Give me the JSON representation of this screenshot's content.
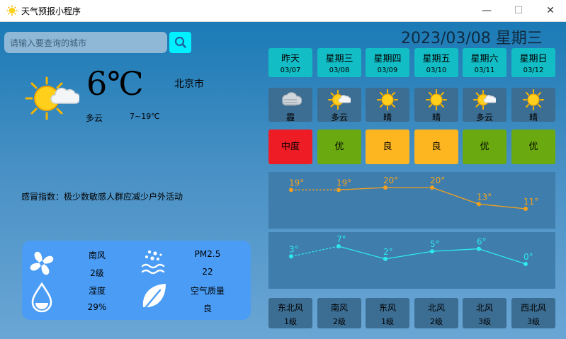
{
  "window": {
    "title": "天气预报小程序",
    "minimize": "—",
    "maximize": "☐",
    "close": "✕"
  },
  "search": {
    "placeholder": "请输入要查询的城市",
    "value": ""
  },
  "date_text": "2023/03/08 星期三",
  "current": {
    "temp": "6℃",
    "city": "北京市",
    "condition": "多云",
    "range": "7~19℃",
    "icon": "partly-cloudy-sun-icon"
  },
  "cold_index": "感冒指数：极少数敏感人群应减少户外活动",
  "details": {
    "wind_dir": "南风",
    "wind_level": "2级",
    "pm_label": "PM2.5",
    "pm_value": "22",
    "humidity_label": "湿度",
    "humidity_value": "29%",
    "air_label": "空气质量",
    "air_value": "良"
  },
  "days": [
    {
      "name": "昨天",
      "date": "03/07",
      "weather": "霾",
      "icon": "haze-icon",
      "aqi": "中度",
      "aqi_color": "#ee1c25",
      "high": 19,
      "low": 3,
      "wind": "东北风",
      "wind_level": "1级"
    },
    {
      "name": "星期三",
      "date": "03/08",
      "weather": "多云",
      "icon": "partly-cloudy-sun-icon",
      "aqi": "优",
      "aqi_color": "#6aa90f",
      "high": 19,
      "low": 7,
      "wind": "南风",
      "wind_level": "2级"
    },
    {
      "name": "星期四",
      "date": "03/09",
      "weather": "晴",
      "icon": "sun-icon",
      "aqi": "良",
      "aqi_color": "#fdb61f",
      "high": 20,
      "low": 2,
      "wind": "东风",
      "wind_level": "1级"
    },
    {
      "name": "星期五",
      "date": "03/10",
      "weather": "晴",
      "icon": "sun-icon",
      "aqi": "良",
      "aqi_color": "#fdb61f",
      "high": 20,
      "low": 5,
      "wind": "北风",
      "wind_level": "2级"
    },
    {
      "name": "星期六",
      "date": "03/11",
      "weather": "多云",
      "icon": "partly-cloudy-sun-icon",
      "aqi": "优",
      "aqi_color": "#6aa90f",
      "high": 13,
      "low": 6,
      "wind": "北风",
      "wind_level": "3级"
    },
    {
      "name": "星期日",
      "date": "03/12",
      "weather": "晴",
      "icon": "sun-icon",
      "aqi": "优",
      "aqi_color": "#6aa90f",
      "high": 11,
      "low": 0,
      "wind": "西北风",
      "wind_level": "3级"
    }
  ],
  "chart_data": [
    {
      "type": "line",
      "categories": [
        "03/07",
        "03/08",
        "03/09",
        "03/10",
        "03/11",
        "03/12"
      ],
      "series": [
        {
          "values": [
            19,
            19,
            20,
            20,
            13,
            11
          ],
          "color": "#f2a01e"
        }
      ],
      "point_labels": [
        "19°",
        "19°",
        "20°",
        "20°",
        "13°",
        "11°"
      ],
      "first_segment": "dashed"
    },
    {
      "type": "line",
      "categories": [
        "03/07",
        "03/08",
        "03/09",
        "03/10",
        "03/11",
        "03/12"
      ],
      "series": [
        {
          "values": [
            3,
            7,
            2,
            5,
            6,
            0
          ],
          "color": "#2ee8f0"
        }
      ],
      "point_labels": [
        "3°",
        "7°",
        "2°",
        "5°",
        "6°",
        "0°"
      ],
      "first_segment": "dashed"
    }
  ]
}
